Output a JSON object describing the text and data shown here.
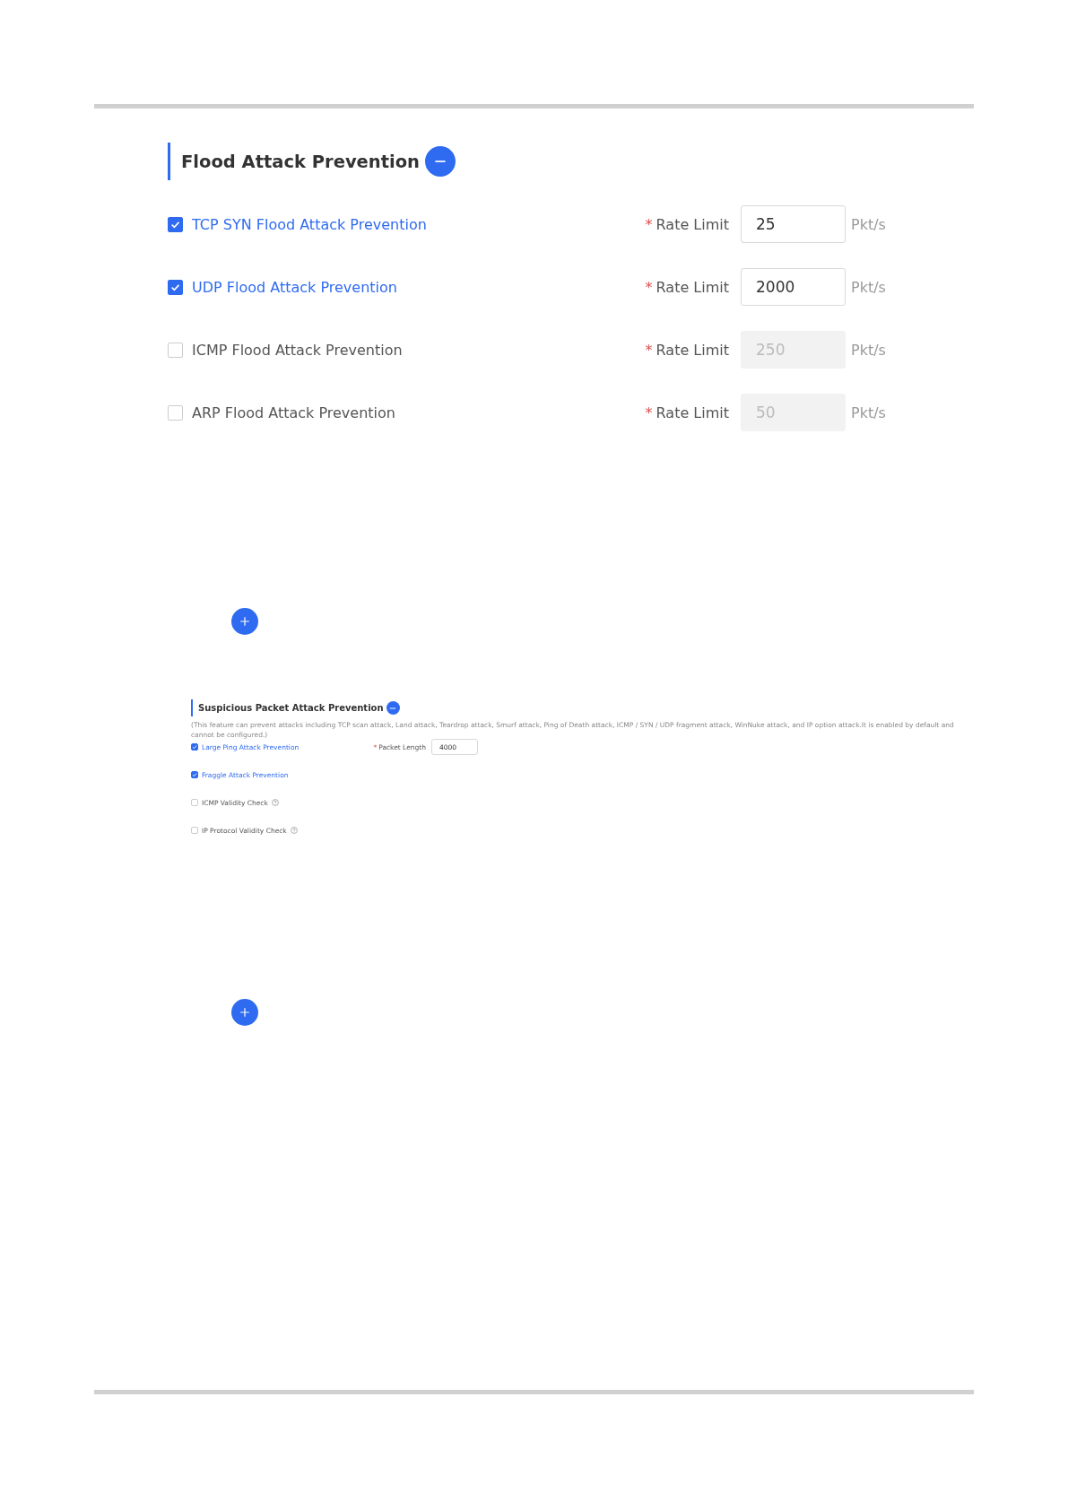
{
  "blocks": [
    {
      "kind": "section",
      "title": "Flood Attack Prevention",
      "expanded": true,
      "rows": [
        {
          "label": "TCP SYN Flood Attack Prevention",
          "checked": true,
          "field": {
            "label": "Rate Limit",
            "required_mark": "*",
            "value": "25",
            "unit": "Pkt/s",
            "disabled": false
          }
        },
        {
          "label": "UDP Flood Attack Prevention",
          "checked": true,
          "field": {
            "label": "Rate Limit",
            "required_mark": "*",
            "value": "2000",
            "unit": "Pkt/s",
            "disabled": false
          }
        },
        {
          "label": "ICMP Flood Attack Prevention",
          "checked": false,
          "field": {
            "label": "Rate Limit",
            "required_mark": "*",
            "value": "250",
            "unit": "Pkt/s",
            "disabled": true
          }
        },
        {
          "label": "ARP Flood Attack Prevention",
          "checked": false,
          "field": {
            "label": "Rate Limit",
            "required_mark": "*",
            "value": "50",
            "unit": "Pkt/s",
            "disabled": true
          }
        }
      ]
    },
    {
      "kind": "add-button"
    },
    {
      "kind": "section",
      "title": "Suspicious Packet Attack Prevention",
      "expanded": true,
      "description": "(This feature can prevent attacks including TCP scan attack, Land attack, Teardrop attack, Smurf attack, Ping of Death attack, ICMP / SYN / UDP fragment attack, WinNuke attack, and IP option attack.It is enabled by default and cannot be configured.)",
      "rows": [
        {
          "label": "Large Ping Attack Prevention",
          "checked": true,
          "field": {
            "label": "Packet Length",
            "required_mark": "*",
            "value": "4000",
            "disabled": false
          }
        },
        {
          "label": "Fraggle Attack Prevention",
          "checked": true
        },
        {
          "label": "ICMP Validity Check",
          "checked": false,
          "help": true
        },
        {
          "label": "IP Protocol Validity Check",
          "checked": false,
          "help": true
        }
      ]
    },
    {
      "kind": "add-button"
    }
  ]
}
